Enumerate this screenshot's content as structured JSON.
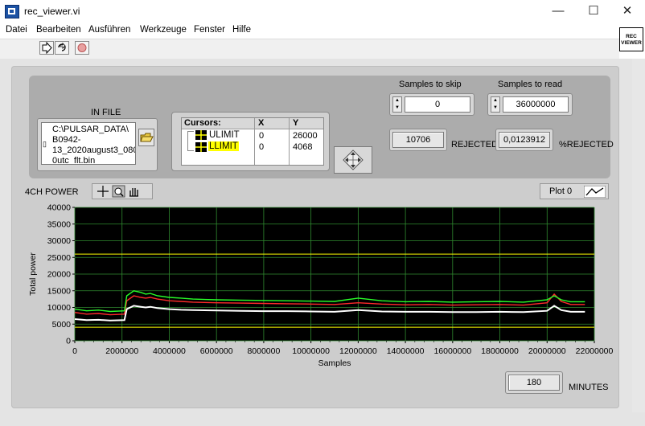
{
  "window": {
    "title": "rec_viewer.vi",
    "minimize_glyph": "—",
    "maximize_glyph": "☐",
    "close_glyph": "✕"
  },
  "menu": [
    "Datei",
    "Bearbeiten",
    "Ausführen",
    "Werkzeuge",
    "Fenster",
    "Hilfe"
  ],
  "toolbar": {
    "run_icon": "run-arrow-icon",
    "run_continuous_icon": "run-continuous-icon",
    "abort_icon": "abort-stop-icon"
  },
  "vi_icon": {
    "line1": "REC",
    "line2": "VIEWER"
  },
  "in_file": {
    "label": "IN FILE",
    "path_lines": [
      "C:\\PULSAR_DATA\\",
      "B0942-",
      "13_2020august3_080",
      "0utc_flt.bin"
    ]
  },
  "cursors": {
    "header": [
      "Cursors:",
      "X",
      "Y"
    ],
    "rows": [
      {
        "name": "ULIMIT",
        "x": "0",
        "y": "26000",
        "highlight": false
      },
      {
        "name": "LLIMIT",
        "x": "0",
        "y": "4068",
        "highlight": true
      }
    ]
  },
  "samples_to_skip": {
    "label": "Samples to skip",
    "value": "0"
  },
  "samples_to_read": {
    "label": "Samples to read",
    "value": "36000000"
  },
  "rejected": {
    "value": "10706",
    "label": "REJECTED"
  },
  "pct_rejected": {
    "value": "0,0123912",
    "label": "%REJECTED"
  },
  "graph": {
    "label": "4CH POWER",
    "plot_legend": "Plot 0"
  },
  "minutes": {
    "value": "180",
    "label": "MINUTES"
  },
  "chart_data": {
    "type": "line",
    "title": "",
    "xlabel": "Samples",
    "ylabel": "Total power",
    "xlim": [
      0,
      22000000
    ],
    "ylim": [
      0,
      40000
    ],
    "x_ticks": [
      "0",
      "2000000",
      "4000000",
      "6000000",
      "8000000",
      "10000000",
      "12000000",
      "14000000",
      "16000000",
      "18000000",
      "20000000",
      "22000000"
    ],
    "y_ticks": [
      "0",
      "5000",
      "10000",
      "15000",
      "20000",
      "25000",
      "30000",
      "35000",
      "40000"
    ],
    "grid": true,
    "background": "#000000",
    "cursor_lines": [
      {
        "name": "ULIMIT",
        "y": 26000,
        "color": "#ffff00"
      },
      {
        "name": "LLIMIT",
        "y": 4068,
        "color": "#ffff00"
      }
    ],
    "series": [
      {
        "color": "#ff2a2a",
        "x": [
          0,
          500000,
          1000000,
          1500000,
          2100000,
          2200000,
          2500000,
          2800000,
          3000000,
          3200000,
          3500000,
          4000000,
          4500000,
          5000000,
          6000000,
          7000000,
          8000000,
          9000000,
          10000000,
          11000000,
          12000000,
          13000000,
          14000000,
          15000000,
          16000000,
          17000000,
          18000000,
          19000000,
          20000000,
          20300000,
          20600000,
          21000000,
          21600000
        ],
        "y": [
          8500,
          8000,
          8200,
          7800,
          8000,
          12000,
          13500,
          13000,
          12800,
          13000,
          12500,
          12000,
          11800,
          11600,
          11400,
          11300,
          11200,
          11100,
          11000,
          10900,
          11400,
          11000,
          10800,
          10900,
          10700,
          10800,
          10900,
          10700,
          11400,
          14000,
          11800,
          10900,
          10900
        ]
      },
      {
        "color": "#29ff29",
        "x": [
          0,
          500000,
          1000000,
          1500000,
          2100000,
          2200000,
          2500000,
          2800000,
          3000000,
          3200000,
          3500000,
          4000000,
          4500000,
          5000000,
          6000000,
          7000000,
          8000000,
          9000000,
          10000000,
          11000000,
          12000000,
          13000000,
          14000000,
          15000000,
          16000000,
          17000000,
          18000000,
          19000000,
          20000000,
          20300000,
          20600000,
          21000000,
          21600000
        ],
        "y": [
          9500,
          9000,
          9200,
          8800,
          9000,
          13500,
          15000,
          14500,
          14000,
          14200,
          13500,
          13000,
          12800,
          12500,
          12300,
          12200,
          12100,
          12000,
          11900,
          11800,
          12800,
          12000,
          11700,
          11800,
          11600,
          11700,
          11800,
          11600,
          12300,
          13500,
          12300,
          11700,
          11700
        ]
      },
      {
        "color": "#ffffff",
        "x": [
          0,
          500000,
          1000000,
          1500000,
          2100000,
          2200000,
          2500000,
          2800000,
          3000000,
          3200000,
          3500000,
          4000000,
          4500000,
          5000000,
          6000000,
          7000000,
          8000000,
          9000000,
          10000000,
          11000000,
          12000000,
          13000000,
          14000000,
          15000000,
          16000000,
          17000000,
          18000000,
          19000000,
          20000000,
          20300000,
          20600000,
          21000000,
          21600000
        ],
        "y": [
          6500,
          6200,
          6300,
          6100,
          6200,
          9500,
          10500,
          10200,
          10000,
          10200,
          9800,
          9500,
          9300,
          9200,
          9100,
          9000,
          8900,
          8900,
          8800,
          8700,
          9200,
          8800,
          8700,
          8700,
          8600,
          8600,
          8700,
          8600,
          9000,
          10500,
          9200,
          8700,
          8700
        ]
      }
    ]
  }
}
